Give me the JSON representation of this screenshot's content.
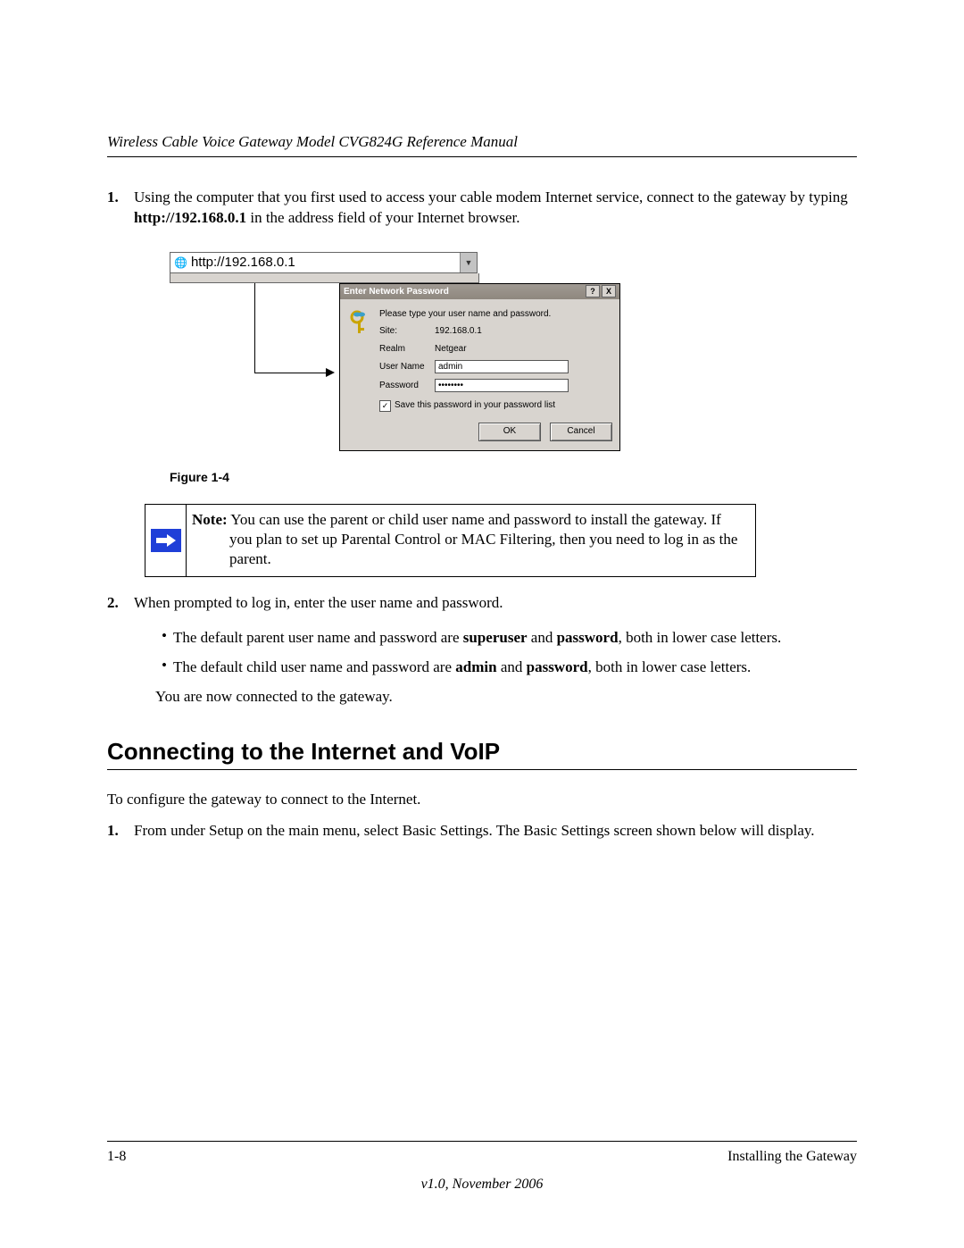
{
  "header": {
    "title": "Wireless Cable Voice Gateway Model CVG824G Reference Manual"
  },
  "step1": {
    "num": "1.",
    "text_a": "Using the computer that you first used to access your cable modem Internet service, connect to the gateway by typing ",
    "bold": "http://192.168.0.1",
    "text_b": " in the address field of your Internet browser."
  },
  "address_bar": {
    "url": "http://192.168.0.1"
  },
  "dialog": {
    "title": "Enter Network Password",
    "intro": "Please type your user name and password.",
    "site_label": "Site:",
    "site_val": "192.168.0.1",
    "realm_label": "Realm",
    "realm_val": "Netgear",
    "user_label": "User Name",
    "user_val": "admin",
    "pass_label": "Password",
    "pass_val": "xxxxxxxx",
    "save_label": "Save this password in your password list",
    "ok": "OK",
    "cancel": "Cancel",
    "help": "?",
    "close": "X"
  },
  "figure_caption": "Figure 1-4",
  "note": {
    "bold": "Note:",
    "text": " You can use the parent or child user name and password to install the gateway. If you plan to set up Parental Control or MAC Filtering, then you need to log in as the parent."
  },
  "step2": {
    "num": "2.",
    "text": "When prompted to log in, enter the user name and password."
  },
  "bullet1": {
    "a": "The default parent user name and password are ",
    "b1": "superuser",
    "mid": " and ",
    "b2": "password",
    "c": ", both in lower case letters."
  },
  "bullet2": {
    "a": "The default child user name and password are ",
    "b1": "admin",
    "mid": " and ",
    "b2": "password",
    "c": ", both in lower case letters."
  },
  "connected_text": "You are now connected to the gateway.",
  "section_heading": "Connecting to the Internet and VoIP",
  "section_intro": "To configure the gateway to connect to the Internet.",
  "sec_step1": {
    "num": "1.",
    "text": "From under Setup on the main menu, select Basic Settings. The Basic Settings screen shown below will display."
  },
  "footer": {
    "page": "1-8",
    "section": "Installing the Gateway",
    "version": "v1.0, November 2006"
  }
}
